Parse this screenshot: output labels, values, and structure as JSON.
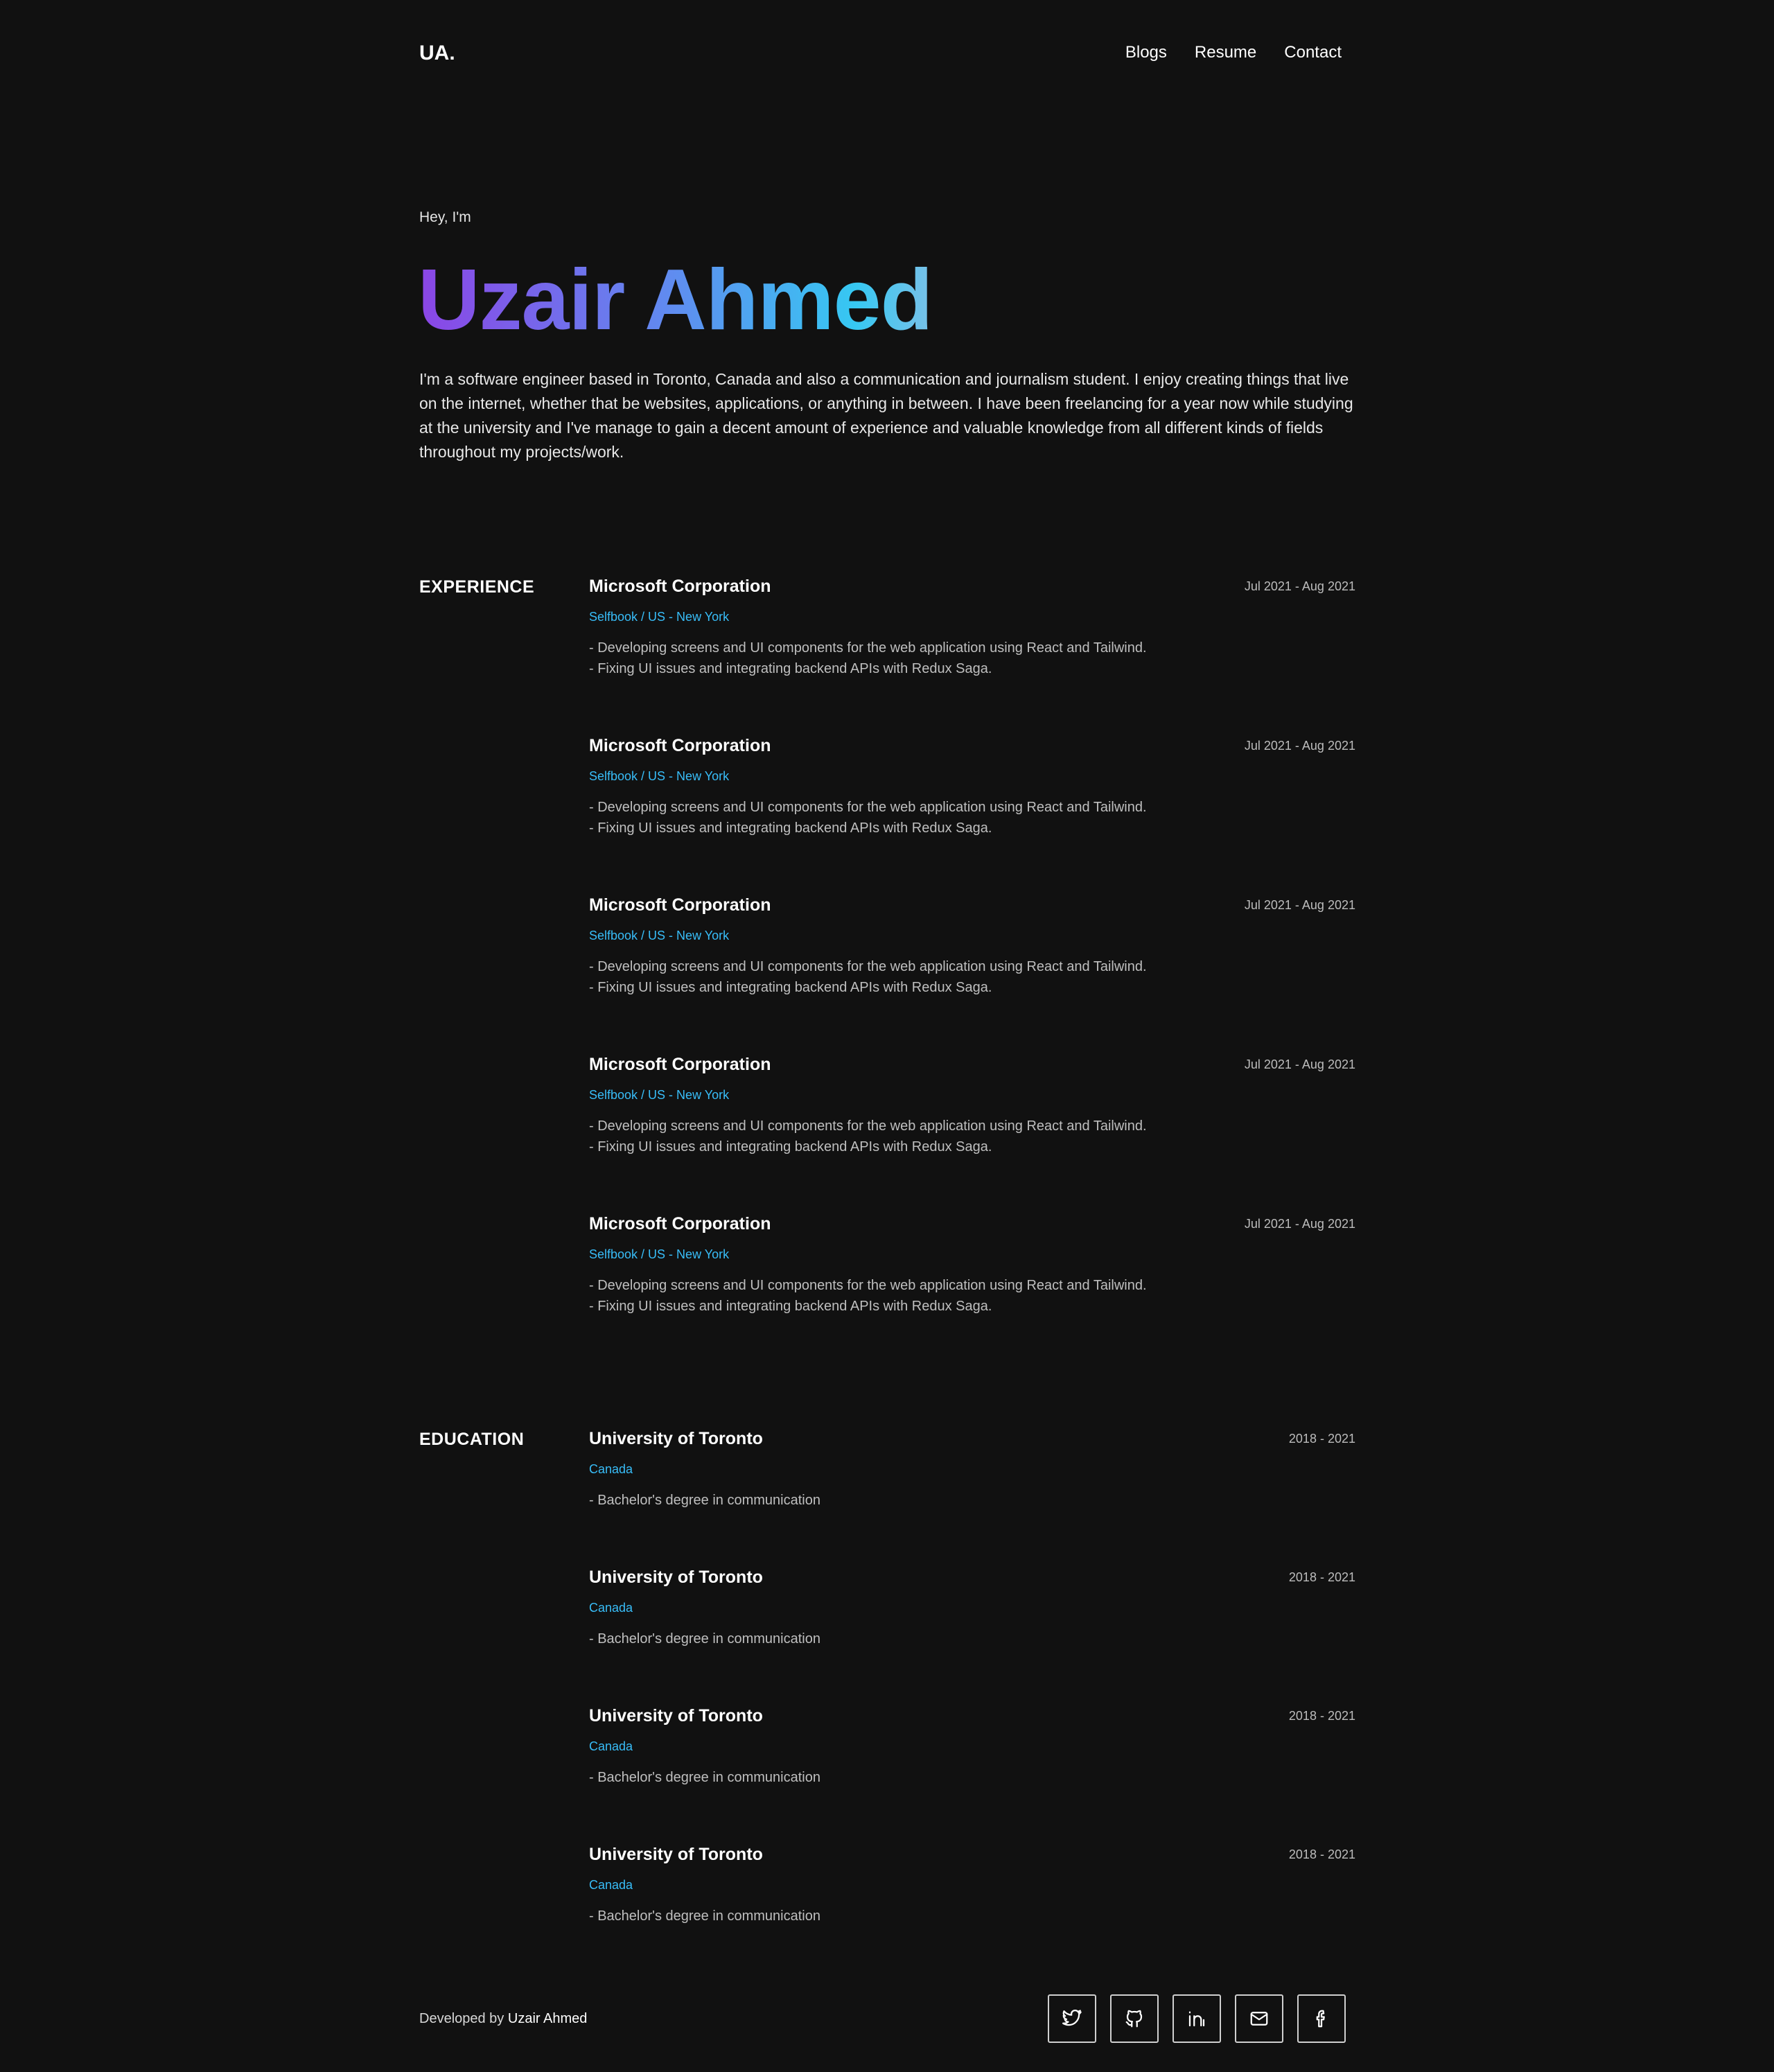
{
  "header": {
    "logo": "UA.",
    "nav": [
      "Blogs",
      "Resume",
      "Contact"
    ]
  },
  "hero": {
    "greeting": "Hey, I'm",
    "name": "Uzair Ahmed",
    "bio": "I'm a software engineer based in Toronto, Canada and also a communication and journalism student. I enjoy creating things that live on the internet, whether that be websites, applications, or anything in between. I have been freelancing for a year now while studying at the university and I've manage to gain a decent amount of experience and valuable knowledge from all different kinds of fields throughout my projects/work."
  },
  "experience": {
    "title": "EXPERIENCE",
    "items": [
      {
        "company": "Microsoft Corporation",
        "date": "Jul 2021 - Aug 2021",
        "sub": "Selfbook / US - New York",
        "lines": [
          "- Developing screens and UI components for the web application using React and Tailwind.",
          "- Fixing UI issues and integrating backend APIs with Redux Saga."
        ]
      },
      {
        "company": "Microsoft Corporation",
        "date": "Jul 2021 - Aug 2021",
        "sub": "Selfbook / US - New York",
        "lines": [
          "- Developing screens and UI components for the web application using React and Tailwind.",
          "- Fixing UI issues and integrating backend APIs with Redux Saga."
        ]
      },
      {
        "company": "Microsoft Corporation",
        "date": "Jul 2021 - Aug 2021",
        "sub": "Selfbook / US - New York",
        "lines": [
          "- Developing screens and UI components for the web application using React and Tailwind.",
          "- Fixing UI issues and integrating backend APIs with Redux Saga."
        ]
      },
      {
        "company": "Microsoft Corporation",
        "date": "Jul 2021 - Aug 2021",
        "sub": "Selfbook / US - New York",
        "lines": [
          "- Developing screens and UI components for the web application using React and Tailwind.",
          "- Fixing UI issues and integrating backend APIs with Redux Saga."
        ]
      },
      {
        "company": "Microsoft Corporation",
        "date": "Jul 2021 - Aug 2021",
        "sub": "Selfbook / US - New York",
        "lines": [
          "- Developing screens and UI components for the web application using React and Tailwind.",
          "- Fixing UI issues and integrating backend APIs with Redux Saga."
        ]
      }
    ]
  },
  "education": {
    "title": "EDUCATION",
    "items": [
      {
        "school": "University of Toronto",
        "date": "2018 - 2021",
        "sub": "Canada",
        "lines": [
          "- Bachelor's degree in communication"
        ]
      },
      {
        "school": "University of Toronto",
        "date": "2018 - 2021",
        "sub": "Canada",
        "lines": [
          "- Bachelor's degree in communication"
        ]
      },
      {
        "school": "University of Toronto",
        "date": "2018 - 2021",
        "sub": "Canada",
        "lines": [
          "- Bachelor's degree in communication"
        ]
      },
      {
        "school": "University of Toronto",
        "date": "2018 - 2021",
        "sub": "Canada",
        "lines": [
          "- Bachelor's degree in communication"
        ]
      }
    ]
  },
  "footer": {
    "credit_prefix": "Developed by",
    "credit_name": "Uzair Ahmed",
    "socials": [
      "twitter-icon",
      "github-icon",
      "linkedin-icon",
      "mail-icon",
      "facebook-icon"
    ]
  },
  "colors": {
    "background": "#111111",
    "accent": "#38bdf8",
    "gradient_start": "#8b45e6",
    "gradient_end": "#36c8f2"
  }
}
